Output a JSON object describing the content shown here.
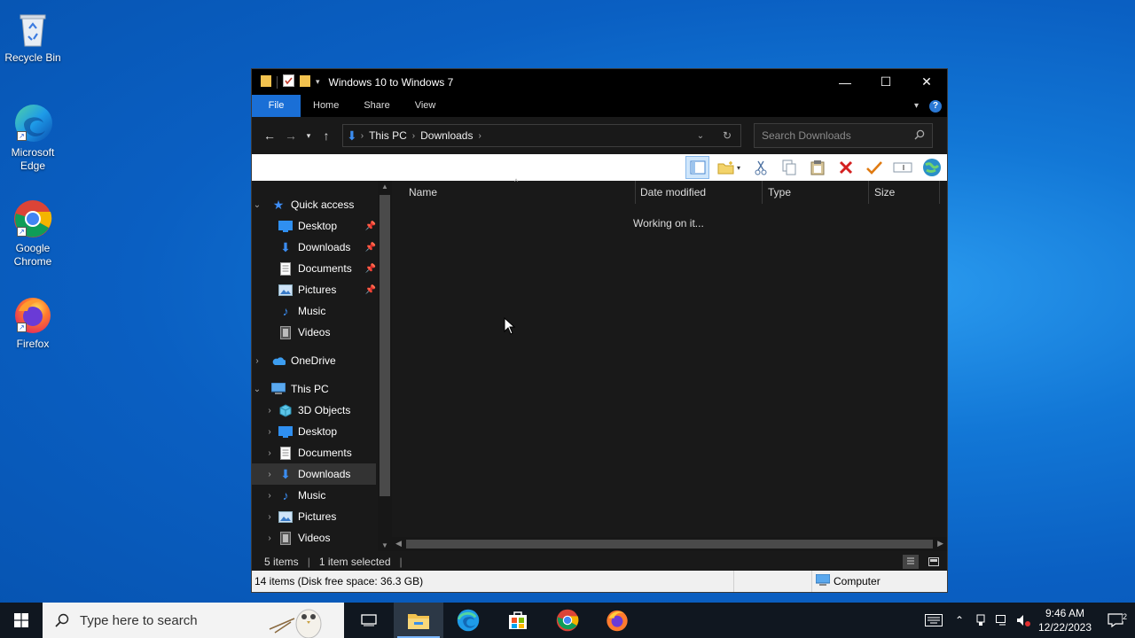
{
  "desktop": {
    "icons": [
      {
        "label": "Recycle Bin",
        "icon": "recycle-bin-icon"
      },
      {
        "label": "Microsoft Edge",
        "icon": "edge-icon"
      },
      {
        "label": "Google Chrome",
        "icon": "chrome-icon"
      },
      {
        "label": "Firefox",
        "icon": "firefox-icon"
      }
    ]
  },
  "window": {
    "title": "Windows 10 to Windows 7",
    "controls": {
      "minimize": "—",
      "maximize": "☐",
      "close": "✕"
    },
    "tabs": [
      "File",
      "Home",
      "Share",
      "View"
    ],
    "help": "?",
    "address": {
      "crumbs": [
        "This PC",
        "Downloads"
      ]
    },
    "search": {
      "placeholder": "Search Downloads"
    },
    "toolbar_icons": [
      "layout-icon",
      "new-folder-icon",
      "cut-icon",
      "copy-icon",
      "paste-icon",
      "delete-icon",
      "check-icon",
      "rename-icon",
      "globe-icon"
    ],
    "nav": {
      "quick_access": "Quick access",
      "quick_items": [
        "Desktop",
        "Downloads",
        "Documents",
        "Pictures",
        "Music",
        "Videos"
      ],
      "onedrive": "OneDrive",
      "this_pc": "This PC",
      "pc_items": [
        "3D Objects",
        "Desktop",
        "Documents",
        "Downloads",
        "Music",
        "Pictures",
        "Videos"
      ]
    },
    "columns": [
      "Name",
      "Date modified",
      "Type",
      "Size"
    ],
    "loading_text": "Working on it...",
    "status": {
      "items": "5 items",
      "selected": "1 item selected"
    },
    "infobar": {
      "left": "14 items (Disk free space: 36.3 GB)",
      "right": "Computer"
    }
  },
  "taskbar": {
    "search_placeholder": "Type here to search",
    "time": "9:46 AM",
    "date": "12/22/2023",
    "notifications": "2"
  },
  "colors": {
    "accent": "#1a6fd6",
    "window_bg": "#191919",
    "taskbar": "#101720"
  }
}
